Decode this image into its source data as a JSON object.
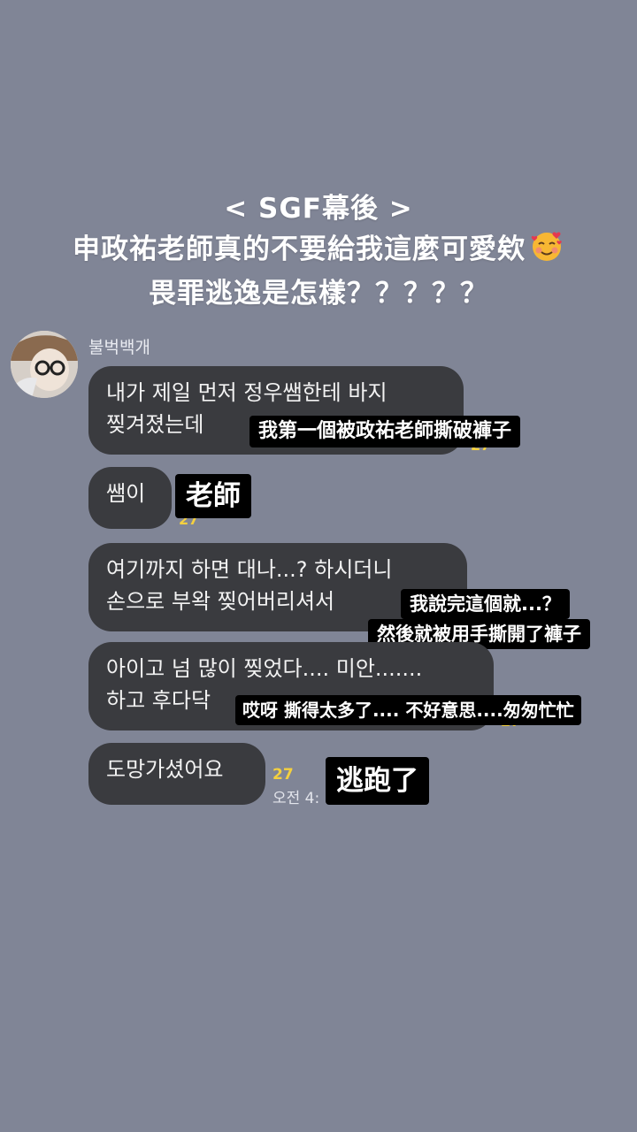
{
  "header": {
    "line1": "< SGF幕後 >",
    "line2": "申政祐老師真的不要給我這麼可愛欸",
    "line3": "畏罪逃逸是怎樣？？？？？",
    "emoji_icon": "smiling-face-with-hearts-icon"
  },
  "chat": {
    "sender_name": "불벅백개",
    "messages": [
      {
        "lines": [
          "내가 제일 먼저 정우쌤한테 바지",
          "찢겨졌는데"
        ],
        "unread": "27",
        "captions": [
          "我第一個被政祐老師撕破褲子"
        ]
      },
      {
        "lines": [
          "쌤이"
        ],
        "unread": "27",
        "captions": [
          "老師"
        ]
      },
      {
        "lines": [
          "여기까지 하면 대나...? 하시더니",
          "손으로 부왁 찢어버리셔서"
        ],
        "captions": [
          "我說完這個就...？",
          "然後就被用手撕開了褲子"
        ]
      },
      {
        "lines": [
          "아이고 넘 많이 찢었다.... 미안.......",
          "하고 후다닥"
        ],
        "unread": "27",
        "captions": [
          "哎呀 撕得太多了.... 不好意思....匆匆忙忙"
        ]
      },
      {
        "lines": [
          "도망가셨어요"
        ],
        "unread": "27",
        "time": "오전 4:",
        "captions": [
          "逃跑了"
        ]
      }
    ]
  },
  "colors": {
    "background": "#808596",
    "bubble": "#3a3b3f",
    "unread": "#f4d03f",
    "caption_bg": "#000000"
  }
}
